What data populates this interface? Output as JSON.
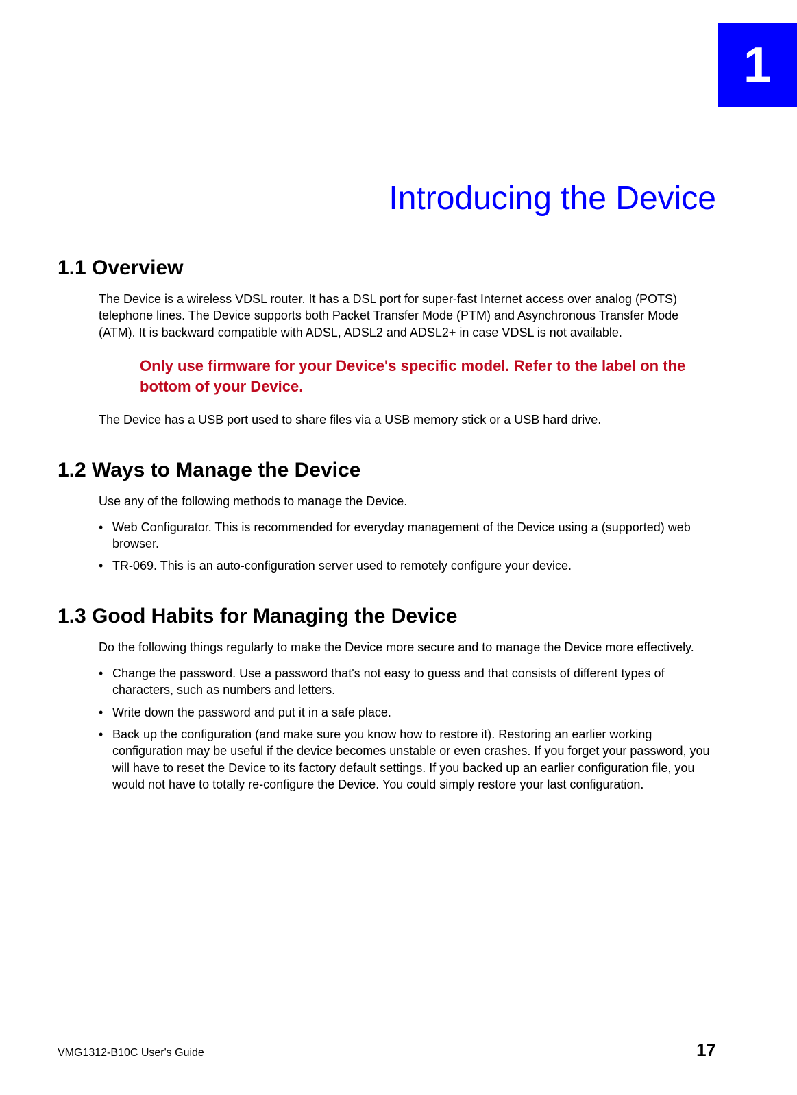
{
  "chapter": {
    "number": "1",
    "title": "Introducing the Device"
  },
  "sections": {
    "s1": {
      "heading": "1.1  Overview",
      "para1": "The Device is a wireless VDSL router. It has a DSL port for super-fast Internet access over analog (POTS) telephone lines. The Device supports both Packet Transfer Mode (PTM) and Asynchronous Transfer Mode (ATM). It is backward compatible with ADSL, ADSL2 and ADSL2+ in case VDSL is not available.",
      "warning": "Only use firmware for your Device's specific model. Refer to the label on the bottom of your Device.",
      "para2": "The Device has a USB port used to share files via a USB memory stick or a USB hard drive."
    },
    "s2": {
      "heading": "1.2  Ways to Manage the Device",
      "intro": "Use any of the following methods to manage the Device.",
      "bullets": [
        "Web Configurator. This is recommended for everyday management of the Device using a (supported) web browser.",
        "TR-069. This is an auto-configuration server used to remotely configure your device."
      ]
    },
    "s3": {
      "heading": "1.3  Good Habits for Managing the Device",
      "intro": "Do the following things regularly to make the Device more secure and to manage the Device more effectively.",
      "bullets": [
        "Change the password. Use a password that's not easy to guess and that consists of different types of characters, such as numbers and letters.",
        "Write down the password and put it in a safe place.",
        "Back up the configuration (and make sure you know how to restore it). Restoring an earlier working configuration may be useful if the device becomes unstable or even crashes. If you forget your password, you will have to reset the Device to its factory default settings. If you backed up an earlier configuration file, you would not have to totally re-configure the Device. You could simply restore your last configuration."
      ]
    }
  },
  "footer": {
    "guide": "VMG1312-B10C User's Guide",
    "page": "17"
  }
}
